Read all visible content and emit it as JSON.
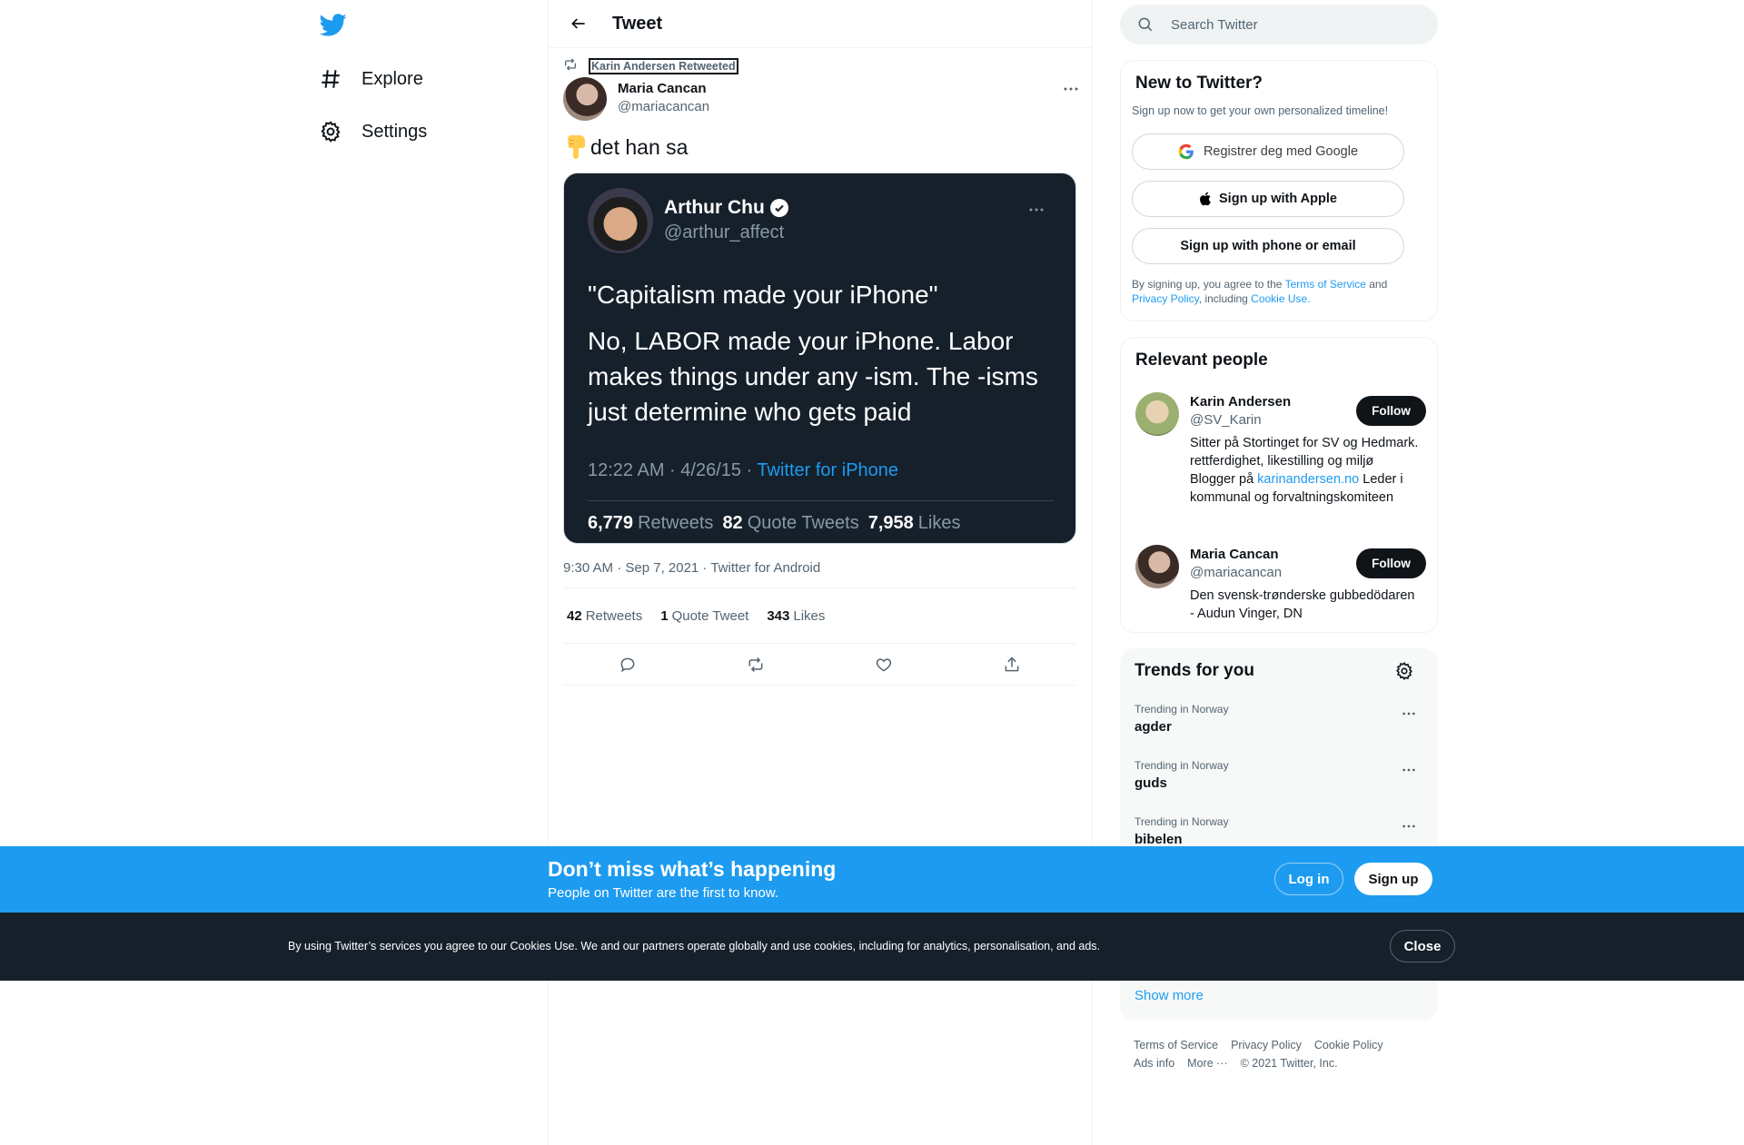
{
  "nav": {
    "items": [
      {
        "label": "Explore",
        "icon": "hashtag-icon"
      },
      {
        "label": "Settings",
        "icon": "gear-icon"
      }
    ]
  },
  "header": {
    "title": "Tweet"
  },
  "tweet": {
    "retweet_context": "Karin Andersen Retweeted",
    "author_name": "Maria Cancan",
    "author_handle": "@mariacancan",
    "text": "det han sa",
    "meta": "9:30 AM · Sep 7, 2021 · Twitter for Android",
    "stats": {
      "retweets_count": "42",
      "retweets_label": "Retweets",
      "quotes_count": "1",
      "quotes_label": "Quote Tweet",
      "likes_count": "343",
      "likes_label": "Likes"
    }
  },
  "embedded_image": {
    "name": "Arthur Chu",
    "handle": "@arthur_affect",
    "quote": "\"Capitalism made your iPhone\"",
    "body": "No, LABOR made your iPhone. Labor makes things under any -ism. The -isms just determine who gets paid",
    "time": "12:22 AM · 4/26/15 · ",
    "app": "Twitter for iPhone",
    "retweets_count": "6,779",
    "retweets_label": "Retweets",
    "quotes_count": "82",
    "quotes_label": "Quote Tweets",
    "likes_count": "7,958",
    "likes_label": "Likes"
  },
  "search": {
    "placeholder": "Search Twitter"
  },
  "new_to_twitter": {
    "title": "New to Twitter?",
    "subtitle": "Sign up now to get your own personalized timeline!",
    "google": "Registrer deg med Google",
    "apple": "Sign up with Apple",
    "phone": "Sign up with phone or email",
    "legal_1": "By signing up, you agree to the ",
    "terms": "Terms of Service",
    "legal_2": " and ",
    "privacy": "Privacy Policy",
    "legal_3": ", including ",
    "cookie": "Cookie Use."
  },
  "relevant_people": {
    "title": "Relevant people",
    "follow_label": "Follow",
    "people": [
      {
        "name": "Karin Andersen",
        "handle": "@SV_Karin",
        "bio_1": "Sitter på Stortinget for SV og Hedmark. rettferdighet, likestilling og miljø Blogger på ",
        "bio_link": "karinandersen.no",
        "bio_2": " Leder i kommunal og forvaltningskomiteen"
      },
      {
        "name": "Maria Cancan",
        "handle": "@mariacancan",
        "bio_1": "Den svensk-trønderske gubbedödaren - Audun Vinger, DN"
      }
    ]
  },
  "trends": {
    "title": "Trends for you",
    "items": [
      {
        "context": "Trending in Norway",
        "name": "agder"
      },
      {
        "context": "Trending in Norway",
        "name": "guds"
      },
      {
        "context": "Trending in Norway",
        "name": "bibelen"
      }
    ],
    "show_more": "Show more"
  },
  "footer": {
    "terms": "Terms of Service",
    "privacy": "Privacy Policy",
    "cookie": "Cookie Policy",
    "ads": "Ads info",
    "more": "More ···",
    "copyright": "© 2021 Twitter, Inc."
  },
  "banner": {
    "title": "Don’t miss what’s happening",
    "subtitle": "People on Twitter are the first to know.",
    "login": "Log in",
    "signup": "Sign up"
  },
  "cookie_bar": {
    "text": "By using Twitter’s services you agree to our Cookies Use. We and our partners operate globally and use cookies, including for analytics, personalisation, and ads.",
    "close": "Close"
  },
  "colors": {
    "accent": "#1d9bf0",
    "text": "#0f1419",
    "secondary": "#536471",
    "embed_bg": "#15202b"
  }
}
